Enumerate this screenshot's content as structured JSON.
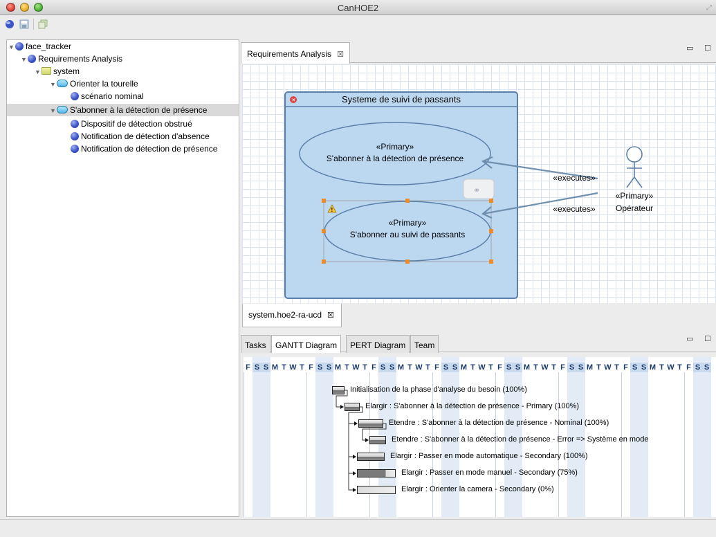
{
  "window": {
    "title": "CanHOE2"
  },
  "tree": {
    "items": [
      {
        "label": "face_tracker",
        "icon": "ball-icon",
        "level": 0,
        "expanded": true
      },
      {
        "label": "Requirements Analysis",
        "icon": "ball-icon",
        "level": 1,
        "expanded": true
      },
      {
        "label": "system",
        "icon": "folder-icon",
        "level": 2,
        "expanded": true
      },
      {
        "label": "Orienter la tourelle",
        "icon": "usecase-icon",
        "level": 3,
        "expanded": true
      },
      {
        "label": "scénario nominal",
        "icon": "ball-icon",
        "level": 4
      },
      {
        "label": "S'abonner à la détection de présence",
        "icon": "usecase-icon",
        "level": 3,
        "expanded": true,
        "selected": true
      },
      {
        "label": "Dispositif de détection obstrué",
        "icon": "ball-icon",
        "level": 4
      },
      {
        "label": "Notification de détection d'absence",
        "icon": "ball-icon",
        "level": 4
      },
      {
        "label": "Notification de détection de présence",
        "icon": "ball-icon",
        "level": 4
      }
    ]
  },
  "editor": {
    "tab_label": "Requirements Analysis",
    "bottom_tab_label": "system.hoe2-ra-ucd",
    "diagram": {
      "system_title": "Systeme de suivi de passants",
      "usecase1_stereo": "«Primary»",
      "usecase1_name": "S'abonner à la détection de présence",
      "usecase2_stereo": "«Primary»",
      "usecase2_name": "S'abonner au suivi de passants",
      "actor_stereo": "«Primary»",
      "actor_name": "Opérateur",
      "link1_label": "«executes»",
      "link2_label": "«executes»"
    }
  },
  "gantt": {
    "tabs": [
      "Tasks",
      "GANTT Diagram",
      "PERT Diagram",
      "Team"
    ],
    "active_tab": 1,
    "days": [
      "F",
      "S",
      "S",
      "M",
      "T",
      "W",
      "T",
      "F",
      "S",
      "S",
      "M",
      "T",
      "W",
      "T",
      "F",
      "S",
      "S",
      "M",
      "T",
      "W",
      "T",
      "F",
      "S",
      "S",
      "M",
      "T",
      "W",
      "T",
      "F",
      "S",
      "S",
      "M",
      "T",
      "W",
      "T",
      "F",
      "S",
      "S",
      "M",
      "T",
      "W",
      "T",
      "F",
      "S",
      "S",
      "M",
      "T",
      "W",
      "T",
      "F",
      "S",
      "S"
    ],
    "tasks": [
      {
        "label": "Initialisation de la phase d'analyse du besoin (100%)",
        "progress": 100
      },
      {
        "label": "Elargir : S'abonner à la détection de présence - Primary (100%)",
        "progress": 100
      },
      {
        "label": "Etendre : S'abonner à la détection de présence - Nominal (100%)",
        "progress": 100
      },
      {
        "label": "Etendre : S'abonner à la détection de présence - Error => Système en mode",
        "progress": 100
      },
      {
        "label": "Elargir : Passer en mode automatique - Secondary (100%)",
        "progress": 100
      },
      {
        "label": "Elargir : Passer en mode manuel - Secondary (75%)",
        "progress": 75
      },
      {
        "label": "Elargir : Orienter la camera - Secondary (0%)",
        "progress": 0
      }
    ]
  },
  "colors": {
    "system_fill": "#bcd8f1",
    "system_border": "#5a7fa8",
    "selection_handle": "#f08a24",
    "grid": "#d9e4f0"
  }
}
